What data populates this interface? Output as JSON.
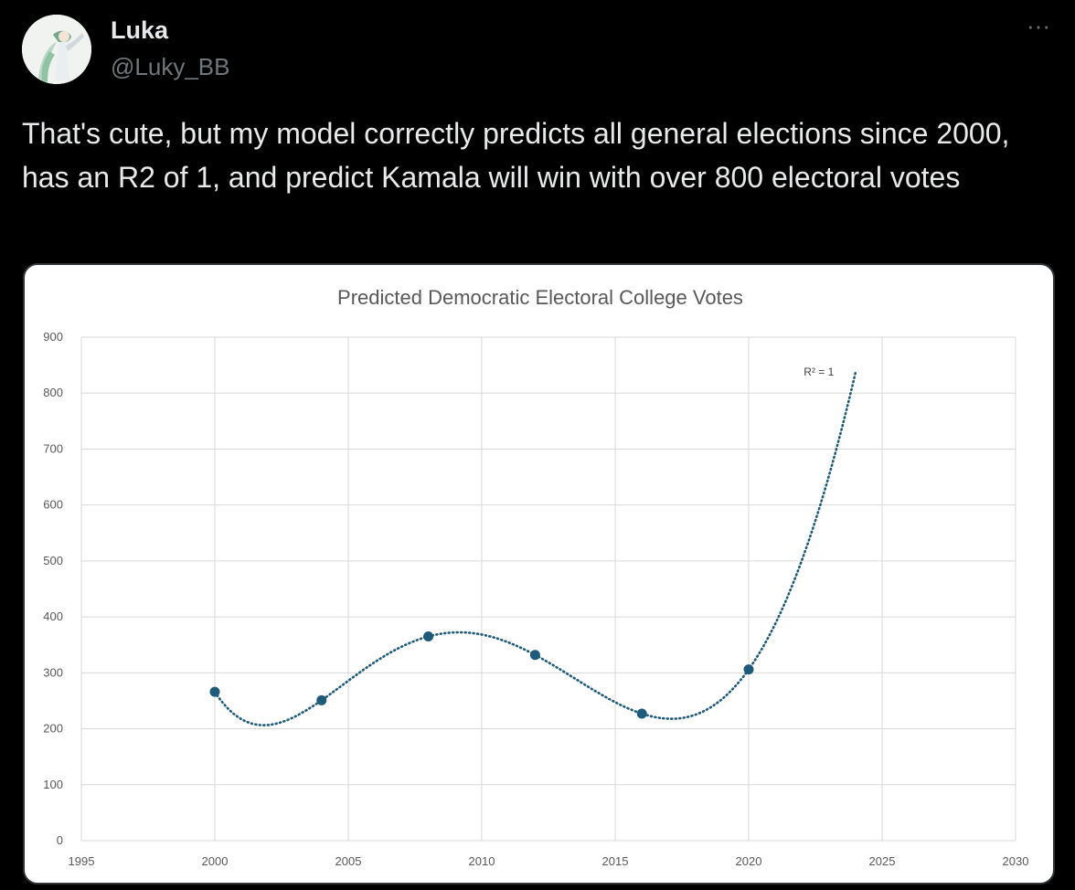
{
  "author": {
    "name": "Luka",
    "handle": "@Luky_BB"
  },
  "more_icon": "more-horizontal-icon",
  "more_label": "···",
  "tweet_text": "That's cute, but my model correctly predicts all general elections since 2000, has an R2 of 1, and predict Kamala will win with over 800 electoral votes",
  "chart_data": {
    "type": "scatter",
    "title": "Predicted Democratic Electoral College Votes",
    "xlabel": "",
    "ylabel": "",
    "xlim": [
      1995,
      2030
    ],
    "ylim": [
      0,
      900
    ],
    "xticks": [
      1995,
      2000,
      2005,
      2010,
      2015,
      2020,
      2025,
      2030
    ],
    "yticks": [
      0,
      100,
      200,
      300,
      400,
      500,
      600,
      700,
      800,
      900
    ],
    "grid": true,
    "x": [
      2000,
      2004,
      2008,
      2012,
      2016,
      2020
    ],
    "y": [
      266,
      251,
      365,
      332,
      227,
      306
    ],
    "trendline": {
      "style": "dotted",
      "x_range": [
        2000,
        2024
      ],
      "annotation": "R² = 1"
    },
    "colors": {
      "marker": "#1f5a7a",
      "trendline": "#1f5a7a"
    }
  }
}
